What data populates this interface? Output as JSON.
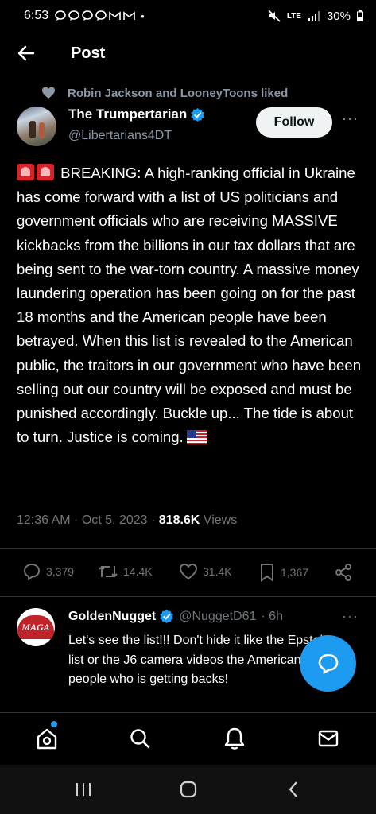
{
  "status_bar": {
    "time": "6:53",
    "notification_icons": [
      "chat-bubble-icon",
      "chat-bubble-icon",
      "chat-bubble-icon",
      "chat-bubble-icon",
      "gmail-icon",
      "gmail-icon"
    ],
    "network": "LTE",
    "battery": "30%"
  },
  "header": {
    "title": "Post"
  },
  "post": {
    "social_context": "Robin Jackson and LooneyToons liked",
    "author_name": "The Trumpertarian",
    "author_handle": "@Libertarians4DT",
    "follow_label": "Follow",
    "text": "BREAKING: A high-ranking official in Ukraine has come forward with a list of US politicians and government officials who are receiving MASSIVE kickbacks from the billions in our tax dollars that are being sent to the war-torn country. A massive money laundering operation has been going on for the past 18 months and the American people have been betrayed. When this list is revealed to the American public, the traitors in our government who have been selling out our country will be exposed and must be punished accordingly. Buckle up... The tide is about to turn. Justice is coming.",
    "timestamp": "12:36 AM · Oct 5, 2023 · ",
    "views_count": "818.6K",
    "views_label": " Views",
    "stats": {
      "replies": "3,379",
      "reposts": "14.4K",
      "likes": "31.4K",
      "bookmarks": "1,367"
    }
  },
  "reply": {
    "avatar_text": "MAGA",
    "author_name": "GoldenNugget",
    "author_handle": "@NuggetD61",
    "time": "· 6h",
    "text": "Let's see the list!!!  Don't hide it like the Epstein list or the J6 camera videos the American people who is getting backs!"
  },
  "colors": {
    "accent": "#1d9bf0",
    "background": "#000000",
    "muted_text": "#71767b"
  }
}
